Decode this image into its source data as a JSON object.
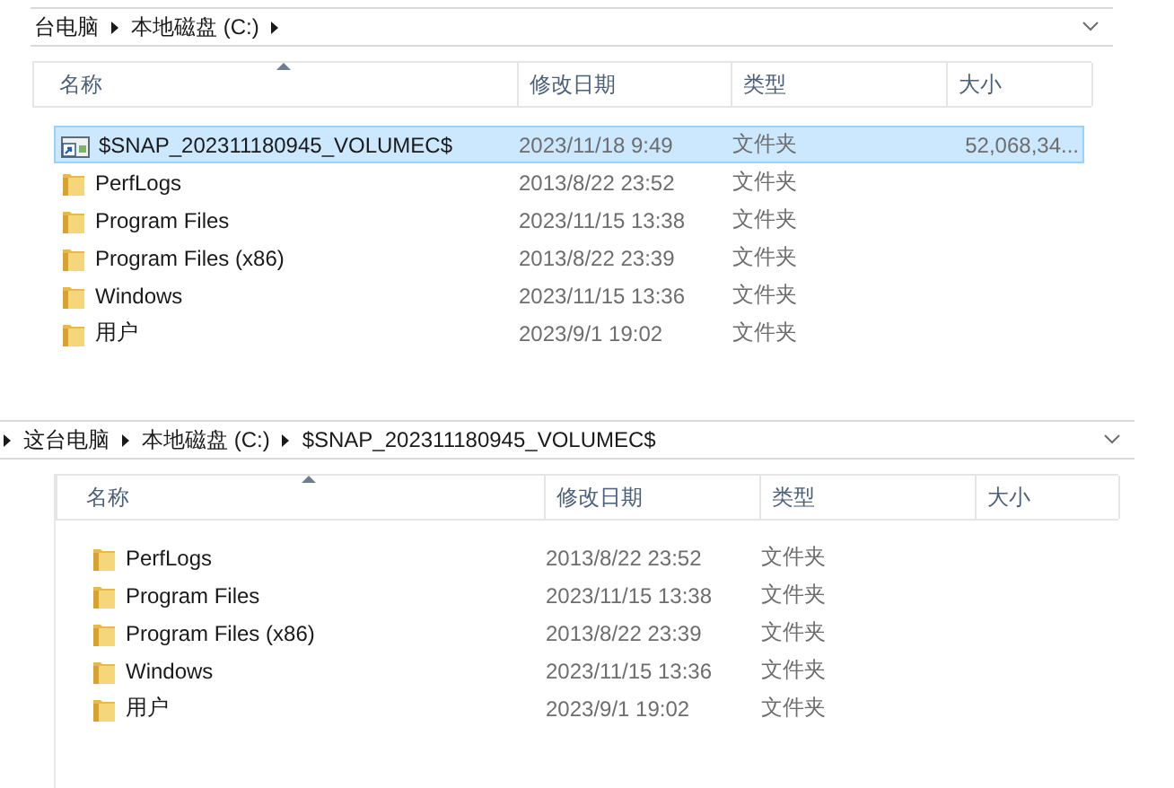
{
  "panels": [
    {
      "breadcrumb": [
        {
          "kind": "crumb",
          "label": "台电脑"
        },
        {
          "kind": "separator"
        },
        {
          "kind": "crumb",
          "label": "本地磁盘 (C:)"
        },
        {
          "kind": "separator"
        }
      ],
      "columns": [
        {
          "label": "名称",
          "sorted": true
        },
        {
          "label": "修改日期",
          "sorted": false
        },
        {
          "label": "类型",
          "sorted": false
        },
        {
          "label": "大小",
          "sorted": false
        }
      ],
      "rows": [
        {
          "kind": "shortcut",
          "name": "$SNAP_202311180945_VOLUMEC$",
          "date": "2023/11/18 9:49",
          "type": "文件夹",
          "size": "52,068,34...",
          "selected": true
        },
        {
          "kind": "folder",
          "name": "PerfLogs",
          "date": "2013/8/22 23:52",
          "type": "文件夹",
          "selected": false
        },
        {
          "kind": "folder",
          "name": "Program Files",
          "date": "2023/11/15 13:38",
          "type": "文件夹",
          "selected": false
        },
        {
          "kind": "folder",
          "name": "Program Files (x86)",
          "date": "2013/8/22 23:39",
          "type": "文件夹",
          "selected": false
        },
        {
          "kind": "folder",
          "name": "Windows",
          "date": "2023/11/15 13:36",
          "type": "文件夹",
          "selected": false
        },
        {
          "kind": "folder",
          "name": "用户",
          "date": "2023/9/1 19:02",
          "type": "文件夹",
          "selected": false
        }
      ]
    },
    {
      "breadcrumb": [
        {
          "kind": "separator"
        },
        {
          "kind": "crumb",
          "label": "这台电脑"
        },
        {
          "kind": "separator"
        },
        {
          "kind": "crumb",
          "label": "本地磁盘 (C:)"
        },
        {
          "kind": "separator"
        },
        {
          "kind": "crumb",
          "label": "$SNAP_202311180945_VOLUMEC$"
        }
      ],
      "columns": [
        {
          "label": "名称",
          "sorted": true
        },
        {
          "label": "修改日期",
          "sorted": false
        },
        {
          "label": "类型",
          "sorted": false
        },
        {
          "label": "大小",
          "sorted": false
        }
      ],
      "rows": [
        {
          "kind": "folder",
          "name": "PerfLogs",
          "date": "2013/8/22 23:52",
          "type": "文件夹",
          "selected": false
        },
        {
          "kind": "folder",
          "name": "Program Files",
          "date": "2023/11/15 13:38",
          "type": "文件夹",
          "selected": false
        },
        {
          "kind": "folder",
          "name": "Program Files (x86)",
          "date": "2013/8/22 23:39",
          "type": "文件夹",
          "selected": false
        },
        {
          "kind": "folder",
          "name": "Windows",
          "date": "2023/11/15 13:36",
          "type": "文件夹",
          "selected": false
        },
        {
          "kind": "folder",
          "name": "用户",
          "date": "2023/9/1 19:02",
          "type": "文件夹",
          "selected": false
        }
      ]
    }
  ]
}
